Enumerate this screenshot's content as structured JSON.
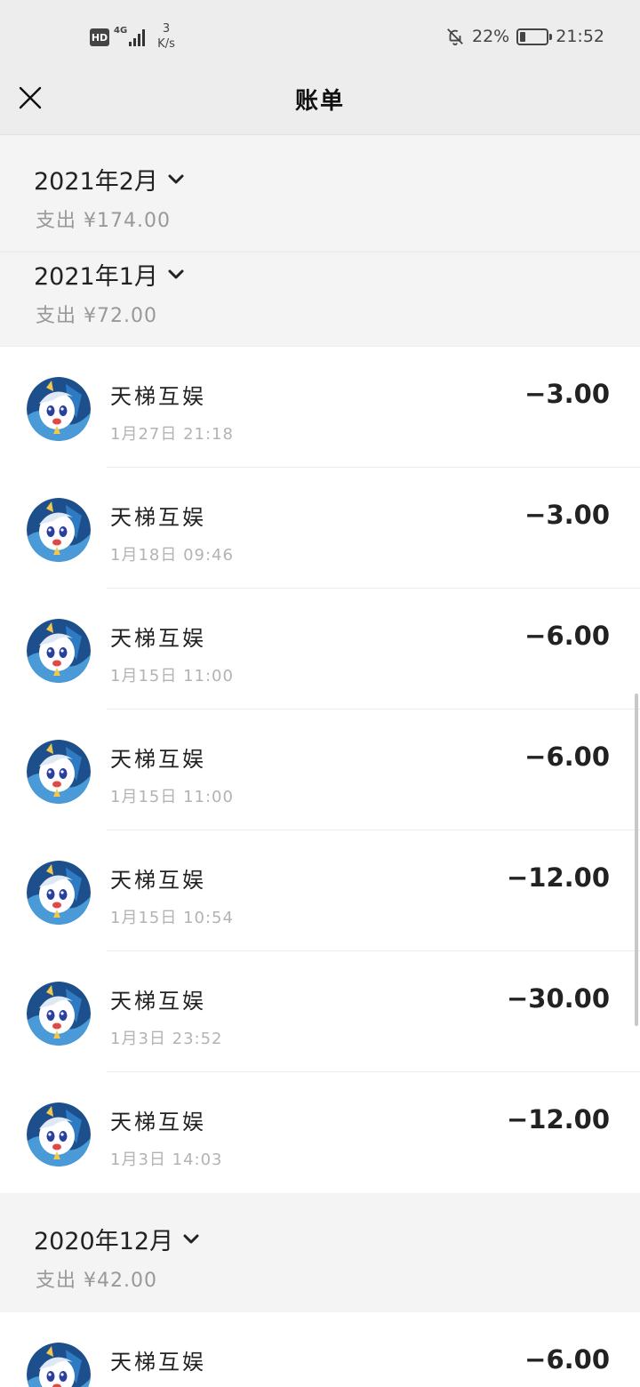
{
  "status_bar": {
    "hd": "HD",
    "network": "4G",
    "speed_value": "3",
    "speed_unit": "K/s",
    "battery_percent_text": "22%",
    "battery_level": 0.22,
    "time": "21:52"
  },
  "nav": {
    "title": "账单",
    "close_icon": "close-icon"
  },
  "months": [
    {
      "label": "2021年2月",
      "summary": "支出 ¥174.00"
    },
    {
      "label": "2021年1月",
      "summary": "支出 ¥72.00"
    },
    {
      "label": "2020年12月",
      "summary": "支出 ¥42.00"
    }
  ],
  "transactions": [
    {
      "name": "天梯互娱",
      "time": "1月27日 21:18",
      "amount": "−3.00"
    },
    {
      "name": "天梯互娱",
      "time": "1月18日 09:46",
      "amount": "−3.00"
    },
    {
      "name": "天梯互娱",
      "time": "1月15日 11:00",
      "amount": "−6.00"
    },
    {
      "name": "天梯互娱",
      "time": "1月15日 11:00",
      "amount": "−6.00"
    },
    {
      "name": "天梯互娱",
      "time": "1月15日 10:54",
      "amount": "−12.00"
    },
    {
      "name": "天梯互娱",
      "time": "1月3日 23:52",
      "amount": "−30.00"
    },
    {
      "name": "天梯互娱",
      "time": "1月3日 14:03",
      "amount": "−12.00"
    },
    {
      "name": "天梯互娱",
      "time": "",
      "amount": "−6.00"
    }
  ],
  "colors": {
    "background": "#ededed",
    "month_header_bg": "#f4f4f4",
    "row_bg": "#ffffff",
    "muted_text": "#999999"
  }
}
